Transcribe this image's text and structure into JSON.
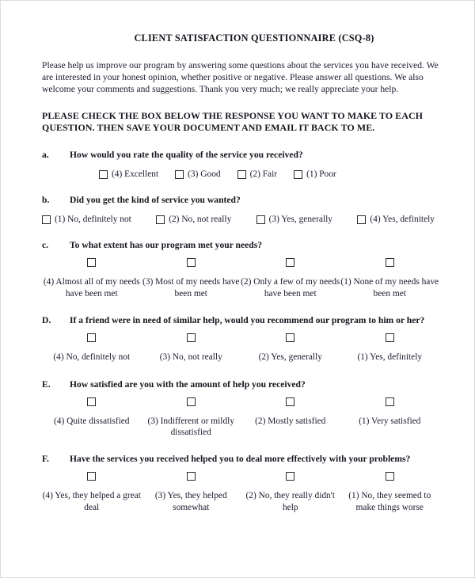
{
  "document": {
    "title": "CLIENT SATISFACTION QUESTIONNAIRE (CSQ-8)",
    "intro": "Please help us improve our program by answering some questions about the services you have received.  We are interested in your honest opinion, whether positive or negative.  Please answer all questions.  We also welcome your comments and suggestions.  Thank you very much; we really appreciate your help.",
    "instruction": "PLEASE CHECK THE BOX BELOW THE RESPONSE YOU WANT TO MAKE TO EACH QUESTION.  THEN SAVE YOUR DOCUMENT AND EMAIL IT BACK TO ME."
  },
  "questions": [
    {
      "letter": "a.",
      "text": "How would you rate the quality of the service you received?",
      "layout": "inline-tight",
      "options": [
        {
          "label": "(4) Excellent"
        },
        {
          "label": "(3) Good"
        },
        {
          "label": "(2) Fair"
        },
        {
          "label": "(1) Poor"
        }
      ]
    },
    {
      "letter": "b.",
      "text": "Did you get the kind of service you wanted?",
      "layout": "inline-spread",
      "options": [
        {
          "label": "(1) No, definitely not"
        },
        {
          "label": "(2) No, not really"
        },
        {
          "label": "(3) Yes, generally"
        },
        {
          "label": "(4) Yes, definitely"
        }
      ]
    },
    {
      "letter": "c.",
      "text": "To what extent has our program met your needs?",
      "layout": "columns",
      "options": [
        {
          "label": "(4) Almost all of my needs have been met"
        },
        {
          "label": "(3) Most of my needs have been met"
        },
        {
          "label": "(2) Only a few of my needs have been met"
        },
        {
          "label": "(1) None of my needs have been met"
        }
      ]
    },
    {
      "letter": "D.",
      "text": "If a friend were in need of similar help, would you recommend our program to him or her?",
      "layout": "columns",
      "options": [
        {
          "label": "(4) No, definitely not"
        },
        {
          "label": "(3) No, not really"
        },
        {
          "label": "(2) Yes, generally"
        },
        {
          "label": "(1) Yes, definitely"
        }
      ]
    },
    {
      "letter": "E.",
      "text": "How satisfied are you with the amount of help you received?",
      "layout": "columns",
      "options": [
        {
          "label": "(4) Quite dissatisfied"
        },
        {
          "label": "(3) Indifferent or mildly dissatisfied"
        },
        {
          "label": "(2) Mostly satisfied"
        },
        {
          "label": "(1) Very satisfied"
        }
      ]
    },
    {
      "letter": "F.",
      "text": "Have the services you received helped you to deal more effectively with your problems?",
      "layout": "columns",
      "options": [
        {
          "label": "(4) Yes, they helped a great deal"
        },
        {
          "label": "(3) Yes, they helped somewhat"
        },
        {
          "label": "(2) No, they really didn't help"
        },
        {
          "label": "(1) No, they seemed to make things worse"
        }
      ]
    }
  ]
}
